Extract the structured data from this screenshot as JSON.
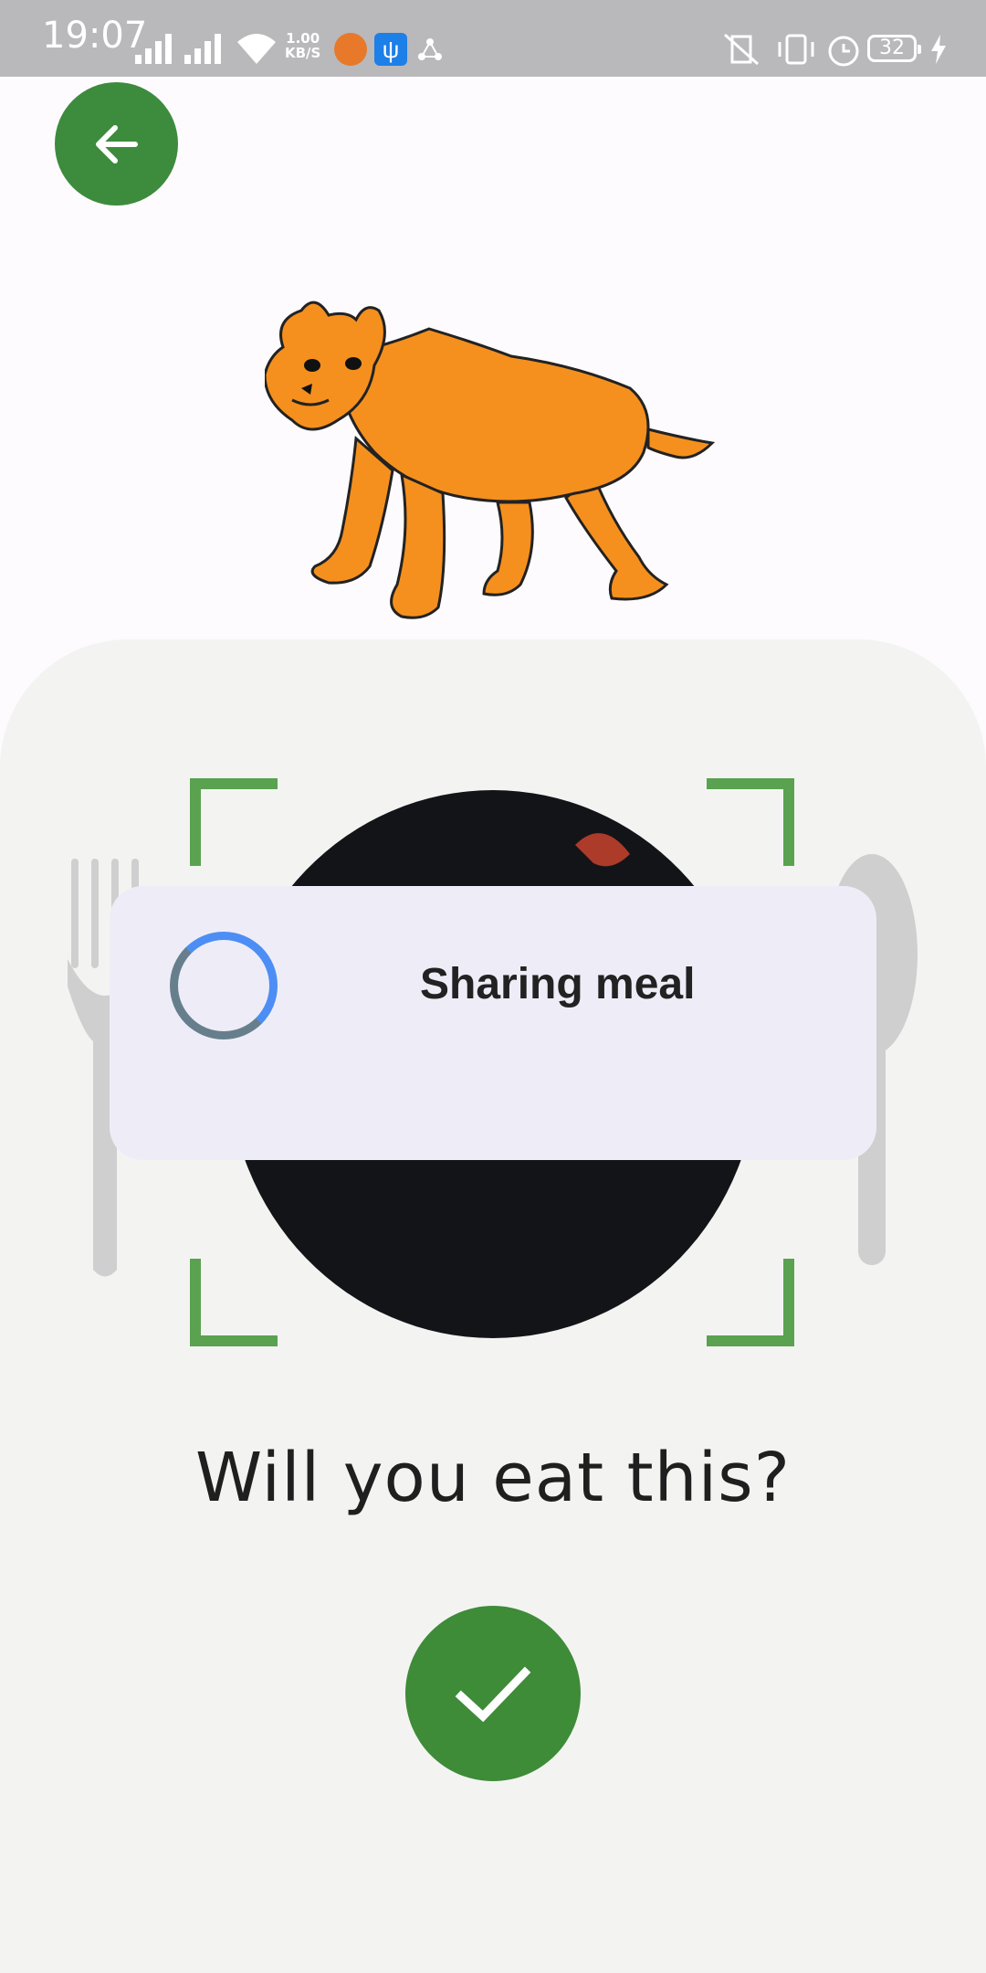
{
  "status_bar": {
    "time": "19:07",
    "net_speed_value": "1.00",
    "net_speed_unit": "KB/S",
    "battery_level": "32"
  },
  "dialog": {
    "title": "Sharing meal"
  },
  "question": {
    "text": "Will you eat this?"
  },
  "colors": {
    "accent_green": "#3d8b3d",
    "frame_green": "#5aa24f",
    "dialog_bg": "#eeedf7",
    "spinner_blue": "#4d8ef4",
    "panel_bg": "#f3f4f2"
  },
  "icons": {
    "back": "arrow-left-icon",
    "confirm": "check-icon"
  }
}
